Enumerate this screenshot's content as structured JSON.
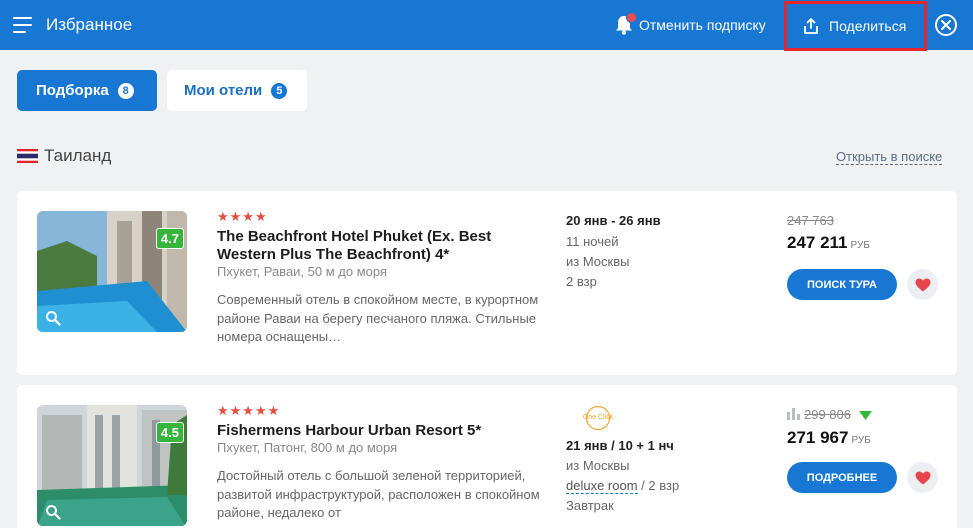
{
  "header": {
    "title": "Избранное",
    "unsubscribe_label": "Отменить подписку",
    "share_label": "Поделиться"
  },
  "tabs": [
    {
      "label": "Подборка",
      "count": "8"
    },
    {
      "label": "Мои отели",
      "count": "5"
    }
  ],
  "section": {
    "country": "Таиланд",
    "open_in_search": "Открыть в поиске"
  },
  "hotels": [
    {
      "stars": "★★★★",
      "rating": "4.7",
      "name": "The Beachfront Hotel Phuket (Ex. Best Western Plus The Beachfront) 4*",
      "location": "Пхукет, Раваи, 50 м до моря",
      "description": "Современный отель в спокойном месте, в курортном районе Раваи на берегу песчаного пляжа. Стильные номера оснащены…",
      "dates": "20 янв - 26 янв",
      "nights": "11 ночей",
      "departure": "из Москвы",
      "guests": "2 взр",
      "old_price": "247 763",
      "price": "247 211",
      "currency": "РУБ",
      "button": "ПОИСК ТУРА"
    },
    {
      "stars": "★★★★★",
      "rating": "4.5",
      "name": "Fishermens Harbour Urban Resort 5*",
      "location": "Пхукет, Патонг, 800 м до моря",
      "description": "Достойный отель с большой зеленой территорией, развитой инфраструктурой, расположен в спокойном районе, недалеко от",
      "operator": "One Click",
      "dates": "21 янв / 10 + 1 нч",
      "departure": "из Москвы",
      "room": "deluxe room",
      "guests": "/ 2 взр",
      "meal": "Завтрак",
      "old_price": "299 806",
      "price": "271 967",
      "currency": "РУБ",
      "button": "ПОДРОБНЕЕ"
    }
  ],
  "colors": {
    "primary": "#1777d2",
    "rating_green": "#37b53a",
    "stars": "#e84c3d",
    "heart": "#e8454d",
    "highlight": "#e8262e"
  }
}
